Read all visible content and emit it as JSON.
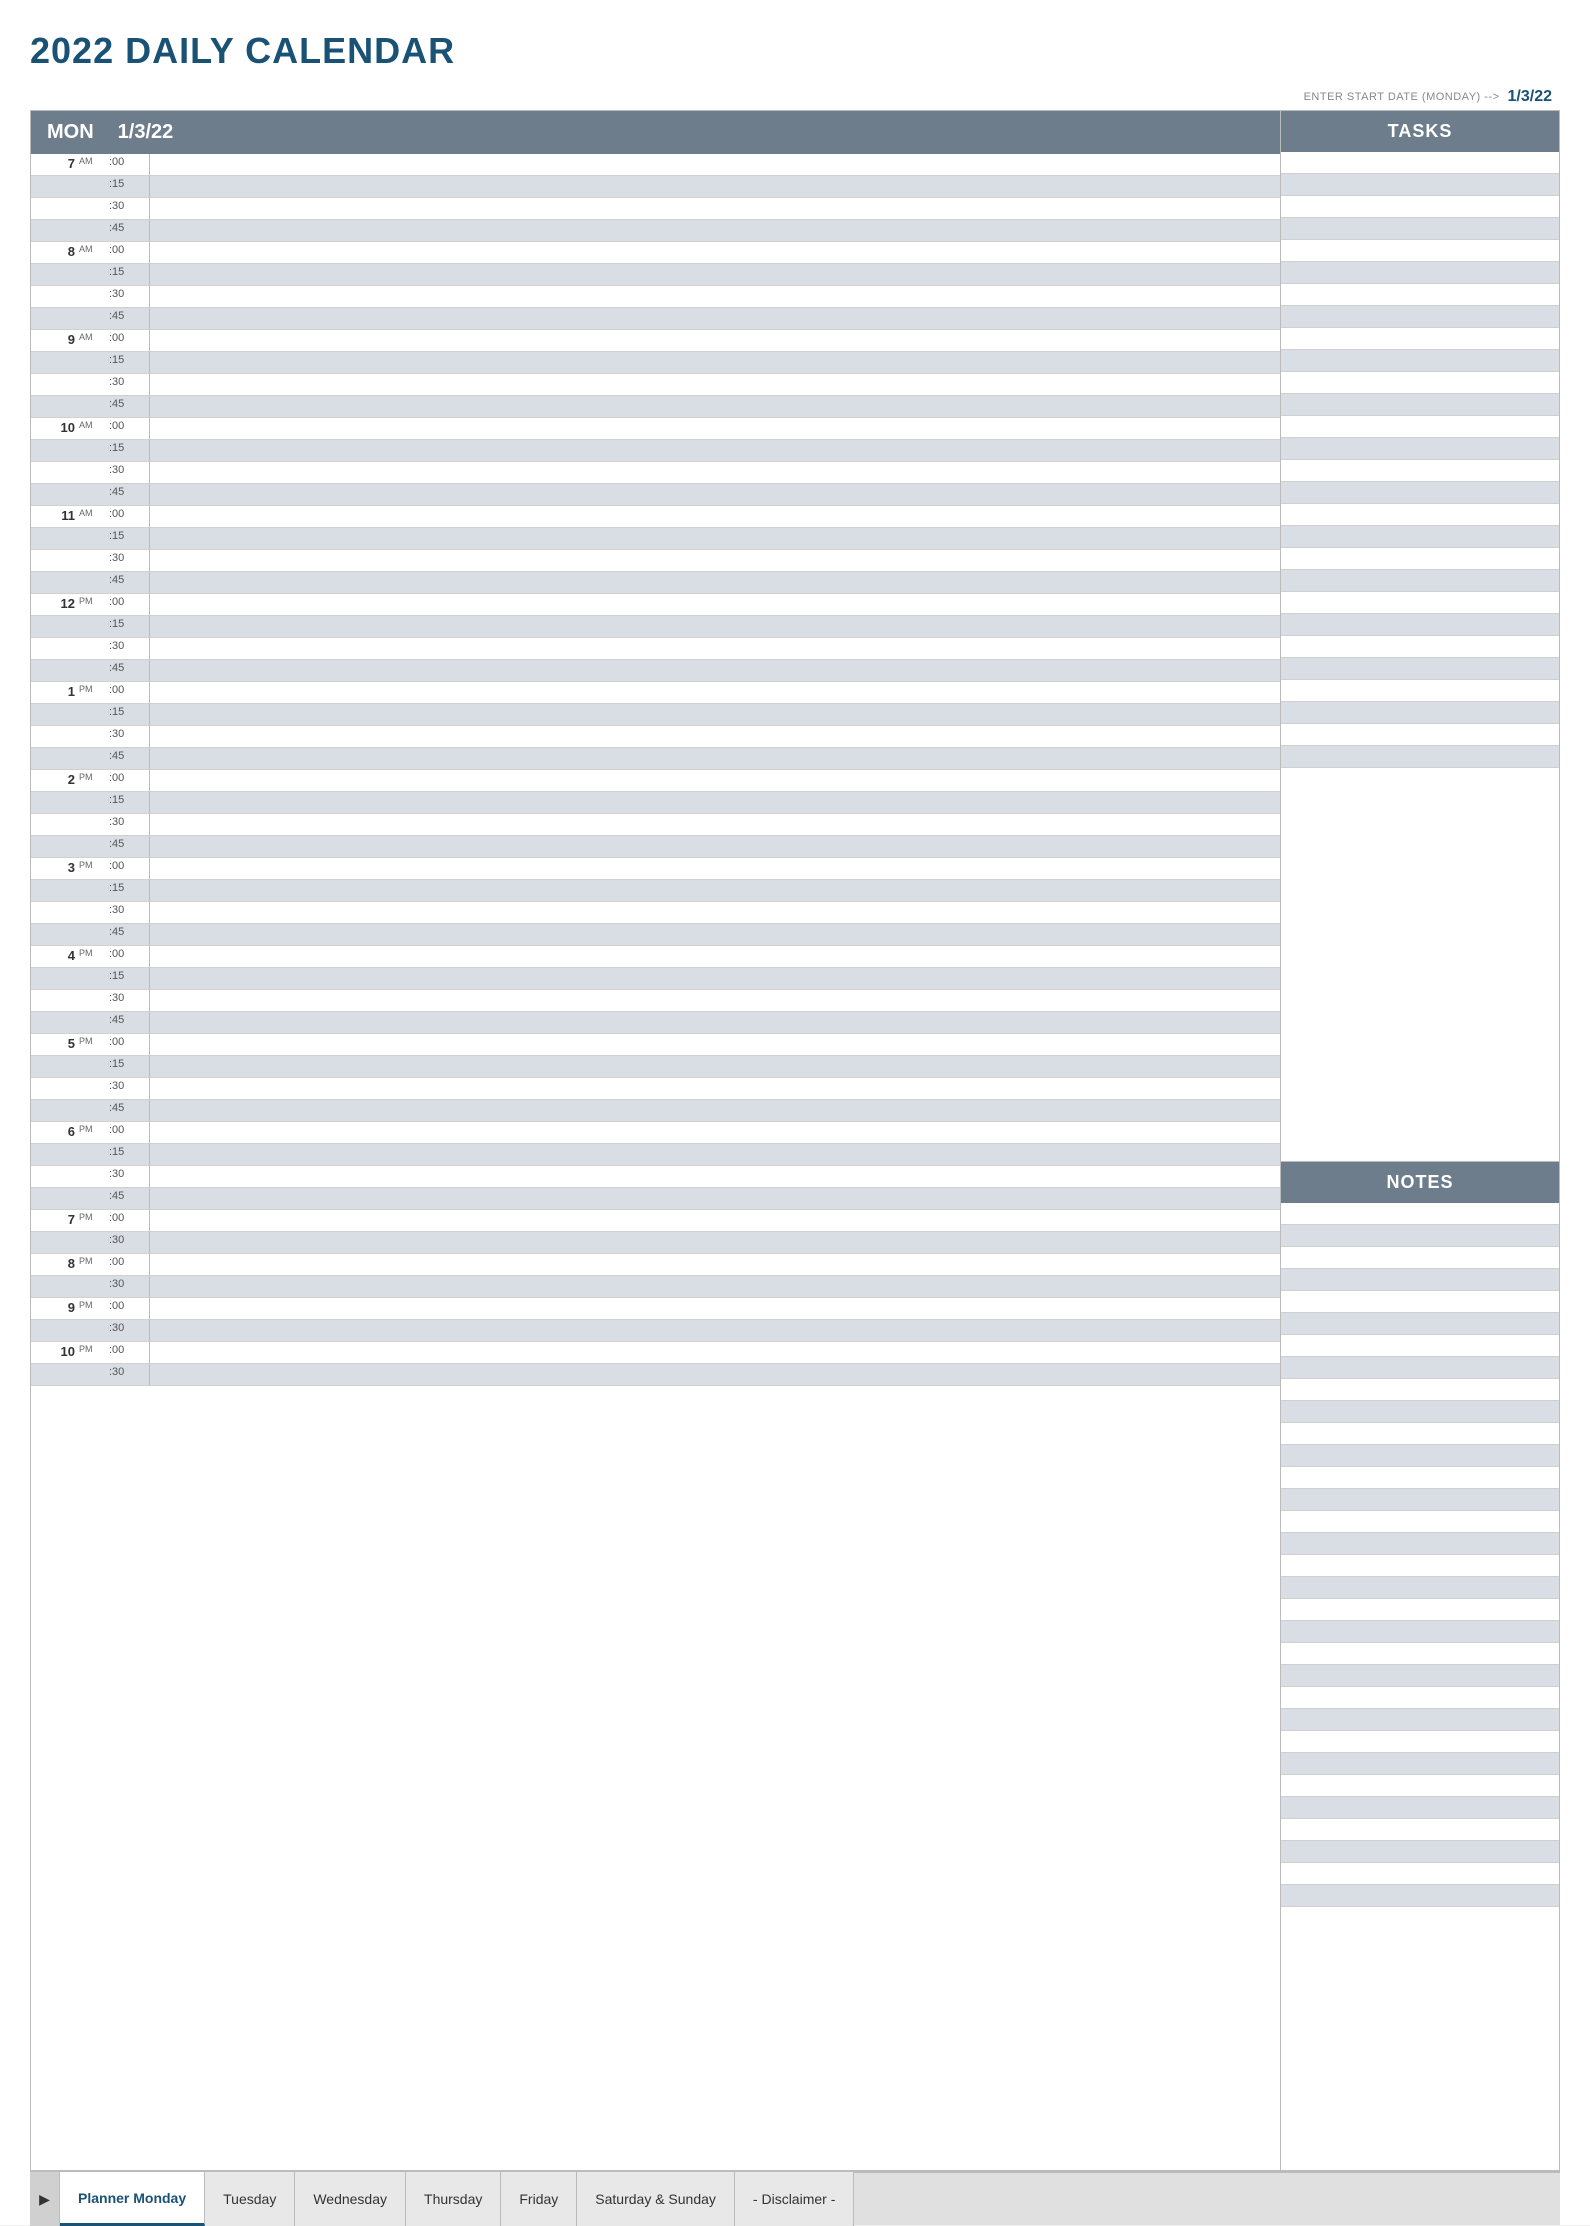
{
  "page": {
    "title": "2022 DAILY CALENDAR",
    "startDateLabel": "ENTER START DATE (MONDAY) -->",
    "startDateValue": "1/3/22",
    "dayLabel": "MON",
    "dateLabel": "1/3/22",
    "tasksLabel": "TASKS",
    "notesLabel": "NOTES"
  },
  "timeSlots": [
    {
      "hour": "7",
      "ampm": "AM",
      "slots": [
        ":00",
        ":15",
        ":30",
        ":45"
      ]
    },
    {
      "hour": "8",
      "ampm": "AM",
      "slots": [
        ":00",
        ":15",
        ":30",
        ":45"
      ]
    },
    {
      "hour": "9",
      "ampm": "AM",
      "slots": [
        ":00",
        ":15",
        ":30",
        ":45"
      ]
    },
    {
      "hour": "10",
      "ampm": "AM",
      "slots": [
        ":00",
        ":15",
        ":30",
        ":45"
      ]
    },
    {
      "hour": "11",
      "ampm": "AM",
      "slots": [
        ":00",
        ":15",
        ":30",
        ":45"
      ]
    },
    {
      "hour": "12",
      "ampm": "PM",
      "slots": [
        ":00",
        ":15",
        ":30",
        ":45"
      ]
    },
    {
      "hour": "1",
      "ampm": "PM",
      "slots": [
        ":00",
        ":15",
        ":30",
        ":45"
      ]
    },
    {
      "hour": "2",
      "ampm": "PM",
      "slots": [
        ":00",
        ":15",
        ":30",
        ":45"
      ]
    },
    {
      "hour": "3",
      "ampm": "PM",
      "slots": [
        ":00",
        ":15",
        ":30",
        ":45"
      ]
    },
    {
      "hour": "4",
      "ampm": "PM",
      "slots": [
        ":00",
        ":15",
        ":30",
        ":45"
      ]
    },
    {
      "hour": "5",
      "ampm": "PM",
      "slots": [
        ":00",
        ":15",
        ":30",
        ":45"
      ]
    },
    {
      "hour": "6",
      "ampm": "PM",
      "slots": [
        ":00",
        ":15",
        ":30",
        ":45"
      ]
    },
    {
      "hour": "7",
      "ampm": "PM",
      "slots": [
        ":00",
        ":30"
      ]
    },
    {
      "hour": "8",
      "ampm": "PM",
      "slots": [
        ":00",
        ":30"
      ]
    },
    {
      "hour": "9",
      "ampm": "PM",
      "slots": [
        ":00",
        ":30"
      ]
    },
    {
      "hour": "10",
      "ampm": "PM",
      "slots": [
        ":00",
        ":30"
      ]
    }
  ],
  "tabs": [
    {
      "label": "Planner Monday",
      "active": true
    },
    {
      "label": "Tuesday",
      "active": false
    },
    {
      "label": "Wednesday",
      "active": false
    },
    {
      "label": "Thursday",
      "active": false
    },
    {
      "label": "Friday",
      "active": false
    },
    {
      "label": "Saturday & Sunday",
      "active": false
    },
    {
      "label": "- Disclaimer -",
      "active": false
    }
  ]
}
